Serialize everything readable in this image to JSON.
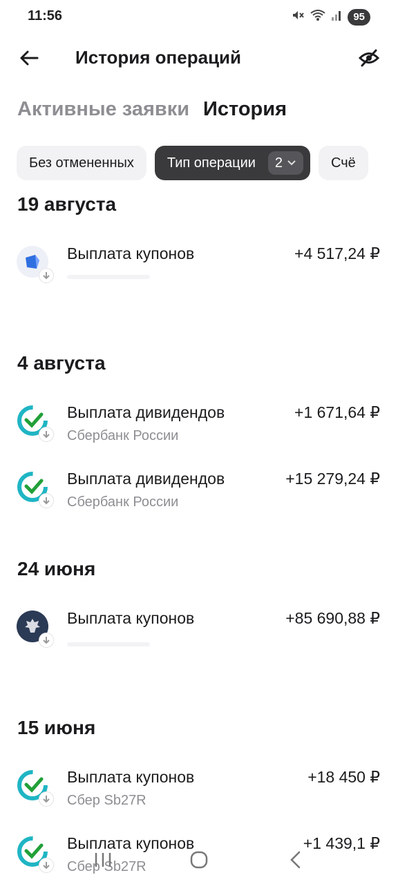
{
  "status_bar": {
    "time": "11:56",
    "battery": "95",
    "icons": [
      "mute-icon",
      "wifi-icon",
      "signal-icon"
    ]
  },
  "header": {
    "title": "История операций",
    "back_icon": "arrow-left-icon",
    "hide_icon": "eye-off-icon"
  },
  "tabs": [
    {
      "label": "Активные заявки",
      "active": false
    },
    {
      "label": "История",
      "active": true
    }
  ],
  "filters": [
    {
      "label": "Без отмененных",
      "active": false
    },
    {
      "label": "Тип операции",
      "active": true,
      "count": "2"
    },
    {
      "label": "Счё",
      "active": false
    }
  ],
  "groups": [
    {
      "date": "19 августа",
      "operations": [
        {
          "title": "Выплата купонов",
          "subtitle": "",
          "amount": "+4 517,24 ₽",
          "logo": "blue-cube-logo"
        }
      ]
    },
    {
      "date": "4 августа",
      "operations": [
        {
          "title": "Выплата дивидендов",
          "subtitle": "Сбербанк России",
          "amount": "+1 671,64 ₽",
          "logo": "sber-logo"
        },
        {
          "title": "Выплата дивидендов",
          "subtitle": "Сбербанк России",
          "amount": "+15 279,24 ₽",
          "logo": "sber-logo"
        }
      ]
    },
    {
      "date": "24 июня",
      "operations": [
        {
          "title": "Выплата купонов",
          "subtitle": "",
          "amount": "+85 690,88 ₽",
          "logo": "minfin-eagle-logo"
        }
      ]
    },
    {
      "date": "15 июня",
      "operations": [
        {
          "title": "Выплата купонов",
          "subtitle": "Сбер Sb27R",
          "amount": "+18 450 ₽",
          "logo": "sber-logo"
        },
        {
          "title": "Выплата купонов",
          "subtitle": "Сбер Sb27R",
          "amount": "+1 439,1 ₽",
          "logo": "sber-logo"
        }
      ]
    }
  ],
  "nav": [
    "recents-icon",
    "home-icon",
    "back-icon"
  ],
  "colors": {
    "sber_green": "#21a038",
    "sber_teal": "#1fb5c4",
    "chip_dark": "#3a3a3c",
    "chip_light": "#f2f2f4",
    "muted_text": "#8e8e93"
  }
}
